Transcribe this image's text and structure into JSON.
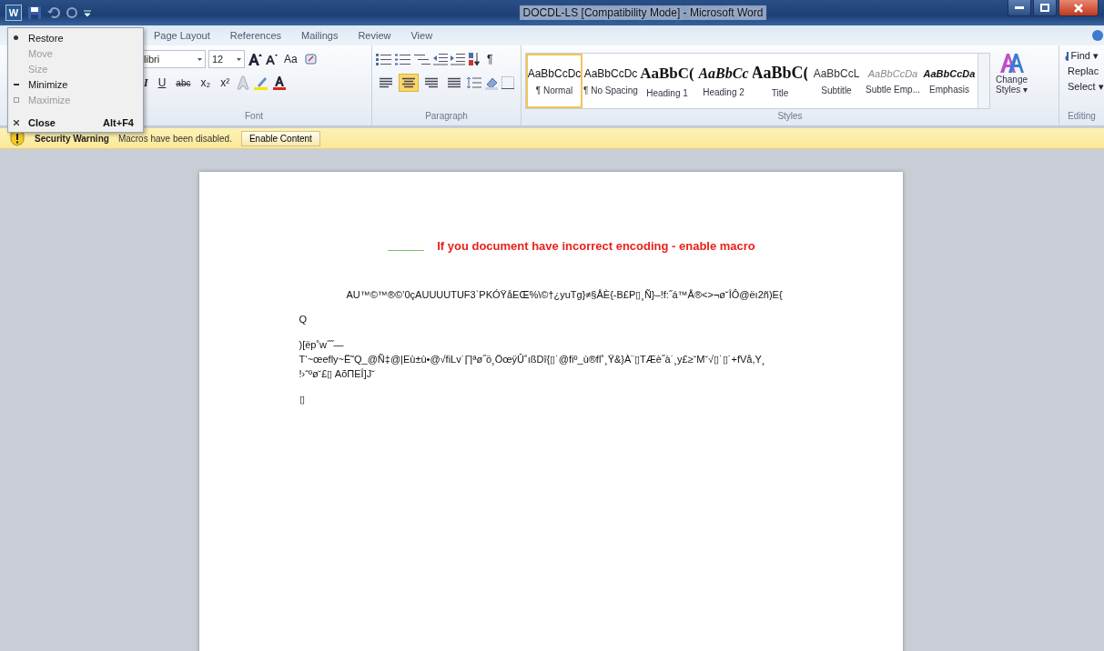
{
  "window": {
    "logo": "W",
    "title": "DOCDL-LS [Compatibility Mode] - Microsoft Word"
  },
  "system_menu": [
    {
      "label": "Restore",
      "kind": "dot",
      "disabled": false,
      "default": false
    },
    {
      "label": "Move",
      "kind": "none",
      "disabled": true,
      "default": false
    },
    {
      "label": "Size",
      "kind": "none",
      "disabled": true,
      "default": false
    },
    {
      "label": "Minimize",
      "kind": "dash",
      "disabled": false,
      "default": false
    },
    {
      "label": "Maximize",
      "kind": "square",
      "disabled": true,
      "default": false
    },
    {
      "label": "Close",
      "kind": "cross",
      "disabled": false,
      "default": true,
      "shortcut": "Alt+F4"
    }
  ],
  "tabs": [
    {
      "label": "Page Layout",
      "selected": false
    },
    {
      "label": "References",
      "selected": false
    },
    {
      "label": "Mailings",
      "selected": false
    },
    {
      "label": "Review",
      "selected": false
    },
    {
      "label": "View",
      "selected": false
    }
  ],
  "font_group": {
    "label": "Font",
    "font_name": "libri",
    "font_size": "12",
    "change_case": "Aa",
    "format_buttons": [
      {
        "label": "I",
        "kind": "italic"
      },
      {
        "label": "U",
        "kind": "underline"
      },
      {
        "label": "abc",
        "kind": "strike"
      },
      {
        "label": "x₂",
        "kind": "plain"
      },
      {
        "label": "x²",
        "kind": "plain"
      }
    ]
  },
  "paragraph_group": {
    "label": "Paragraph",
    "pilcrow": "¶",
    "align": [
      {
        "selected": false
      },
      {
        "selected": true
      },
      {
        "selected": false
      },
      {
        "selected": false
      }
    ]
  },
  "styles_group": {
    "label": "Styles",
    "styles": [
      {
        "preview": "AaBbCcDc",
        "name": "¶ Normal",
        "kind": "normal",
        "selected": true
      },
      {
        "preview": "AaBbCcDc",
        "name": "¶ No Spacing",
        "kind": "normal",
        "selected": false
      },
      {
        "preview": "AaBbC(",
        "name": "Heading 1",
        "kind": "heading1",
        "selected": false
      },
      {
        "preview": "AaBbCc",
        "name": "Heading 2",
        "kind": "heading2",
        "selected": false
      },
      {
        "preview": "AaBbC(",
        "name": "Title",
        "kind": "title",
        "selected": false
      },
      {
        "preview": "AaBbCcL",
        "name": "Subtitle",
        "kind": "subtitle",
        "selected": false
      },
      {
        "preview": "AaBbCcDa",
        "name": "Subtle Emp...",
        "kind": "subtle",
        "selected": false
      },
      {
        "preview": "AaBbCcDa",
        "name": "Emphasis",
        "kind": "emphasis",
        "selected": false
      }
    ],
    "change_styles": [
      "Change",
      "Styles ▾"
    ]
  },
  "editing_group": {
    "label": "Editing",
    "items": [
      "Find ▾",
      "Replac",
      "Select ▾"
    ]
  },
  "security_bar": {
    "title": "Security Warning",
    "message": "Macros have been disabled.",
    "button": "Enable Content"
  },
  "document": {
    "heading": "If you document have incorrect encoding - enable macro",
    "centered_line": "AU™©™®©’0çAUUUUTUF3`PKÓŸåEŒ%\\©†¿yuTg}≠§ÅÈ{-B£P▯¸Ñ}–!f:˝á™Å®<>¬ø˘ÎÔ@ëı2ñ)E{",
    "paragraphs": [
      [
        "Q"
      ],
      [
        ")[ëp˚w˝˝—",
        "T‘~œefly~Ë˜Q_@Ñ‡@|Eù±ù•@√fiLv˙∏ªø˝ö¸ÖœÿÛ˚ıßDî{▯˙@fiº_ù®fl˚¸Ÿ&}À¨▯TÆè˝à˙¸y£≥˘M˘√▯˙▯˙+fVå,Y¸",
        "!›“ºø˘£▯ AõΠEÎ]J˘"
      ],
      [
        "▯"
      ]
    ]
  }
}
